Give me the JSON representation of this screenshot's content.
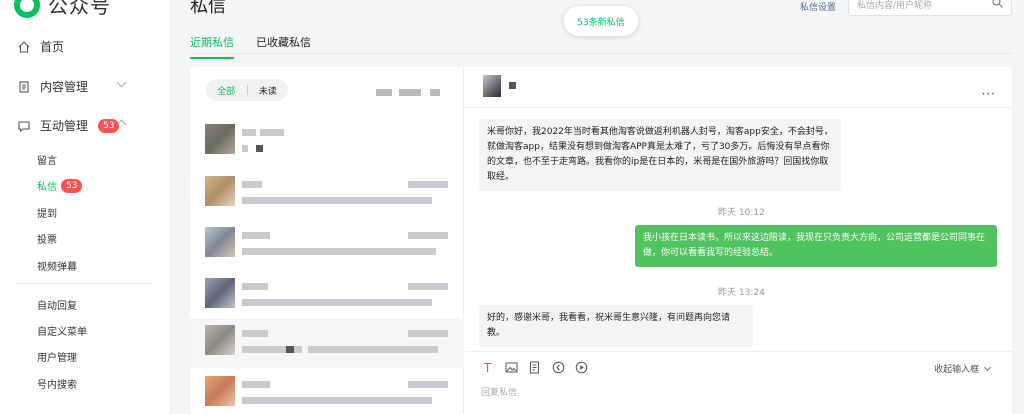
{
  "app": {
    "name": "公众号"
  },
  "sidebar": {
    "home": "首页",
    "content": "内容管理",
    "interaction": "互动管理",
    "interaction_badge": "53",
    "sub": {
      "comments": "留言",
      "messages": "私信",
      "messages_badge": "53",
      "mentions": "提到",
      "votes": "投票",
      "danmaku": "视频弹幕"
    },
    "tools": {
      "auto_reply": "自动回复",
      "custom_menu": "自定义菜单",
      "users": "用户管理",
      "search": "号内搜索"
    }
  },
  "header": {
    "title": "私信",
    "new_messages": "53条新私信",
    "settings": "私信设置",
    "search_placeholder": "私信内容/用户昵称"
  },
  "tabs": {
    "recent": "近期私信",
    "saved": "已收藏私信"
  },
  "filter": {
    "all": "全部",
    "unread": "未读"
  },
  "chat": {
    "messages": [
      {
        "dir": "in",
        "text": "米哥你好，我2022年当时看其他淘客说做返利机器人封号，淘客app安全，不会封号，就做淘客app，结果没有想到做淘客APP真是太难了，亏了30多万。后悔没有早点看你的文章，也不至于走弯路。我看你的ip是在日本的，米哥是在国外旅游吗？回国找你取取经。"
      },
      {
        "time": "昨天 10:12"
      },
      {
        "dir": "out",
        "text": "我小孩在日本读书，所以来这边陪读，我现在只负责大方向，公司运营都是公司同事在做，你可以看看我写的经验总结。"
      },
      {
        "time": "昨天 13:24"
      },
      {
        "dir": "in",
        "text": "好的，感谢米哥，我看看，祝米哥生意兴隆，有问题再向您请教。"
      }
    ],
    "collapse": "收起输入框",
    "reply_placeholder": "回复私信"
  },
  "colors": {
    "accent": "#07c160",
    "badge": "#fa5151",
    "outgoing": "#4fc35d"
  }
}
